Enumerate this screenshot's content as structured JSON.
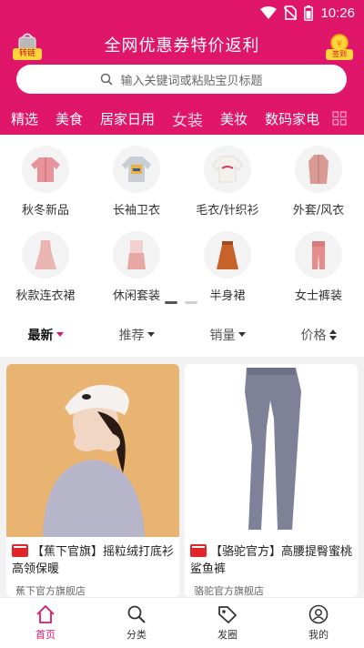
{
  "status_bar": {
    "time": "10:26",
    "icons": [
      "wifi-icon",
      "no-sim-icon",
      "battery-icon"
    ]
  },
  "header": {
    "title": "全网优惠券特价返利",
    "convert_label": "转链",
    "signin_label": "签到",
    "search_placeholder": "输入关键词或粘贴宝贝标题",
    "brand_color": "#e0166a"
  },
  "category_tabs": [
    {
      "label": "精选",
      "active": false
    },
    {
      "label": "美食",
      "active": false
    },
    {
      "label": "居家日用",
      "active": false
    },
    {
      "label": "女装",
      "active": true
    },
    {
      "label": "美妆",
      "active": false
    },
    {
      "label": "数码家电",
      "active": false
    }
  ],
  "subcategories": [
    {
      "label": "秋冬新品",
      "icon": "jacket-icon"
    },
    {
      "label": "长袖卫衣",
      "icon": "sweatshirt-icon"
    },
    {
      "label": "毛衣/针织衫",
      "icon": "sweater-icon"
    },
    {
      "label": "外套/风衣",
      "icon": "coat-icon"
    },
    {
      "label": "秋款连衣裙",
      "icon": "dress-icon"
    },
    {
      "label": "休闲套装",
      "icon": "outfit-icon"
    },
    {
      "label": "半身裙",
      "icon": "skirt-icon"
    },
    {
      "label": "女士裤装",
      "icon": "pants-icon"
    }
  ],
  "pager": {
    "current_page": 1,
    "total_pages": 2
  },
  "sort_bar": [
    {
      "label": "最新",
      "active": true
    },
    {
      "label": "推荐",
      "active": false
    },
    {
      "label": "销量",
      "active": false
    },
    {
      "label": "价格",
      "active": false
    }
  ],
  "products": [
    {
      "title": "【蕉下官旗】摇粒绒打底衫高领保暖",
      "shop": "蕉下官方旗舰店",
      "image": "woman-in-beret-photo"
    },
    {
      "title": "【骆驼官方】高腰提臀蜜桃鲨鱼裤",
      "shop": "骆驼官方旗舰店",
      "image": "leggings-photo"
    }
  ],
  "bottom_nav": [
    {
      "label": "首页",
      "icon": "home-icon",
      "active": true
    },
    {
      "label": "分类",
      "icon": "search-icon",
      "active": false
    },
    {
      "label": "发圈",
      "icon": "tag-icon",
      "active": false
    },
    {
      "label": "我的",
      "icon": "user-icon",
      "active": false
    }
  ]
}
